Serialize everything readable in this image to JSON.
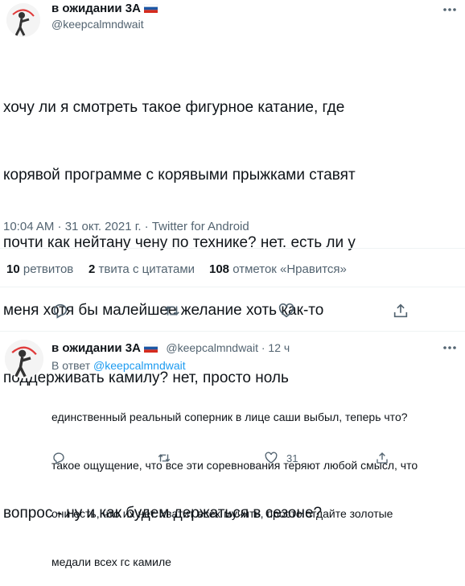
{
  "main_tweet": {
    "author_name": "в ожидании 3А",
    "author_handle": "@keepcalmndwait",
    "text_line_1": "хочу ли я смотреть такое фигурное катание, где",
    "text_line_2": "корявой программе с корявыми прыжками ставят",
    "text_line_3": "почти как нейтану чену по технике? нет. есть ли у",
    "text_line_4": "меня хотя бы малейшее желание хоть как-то",
    "text_line_5": "поддерживать камилу? нет, просто ноль",
    "text_line_6": "вопрос - ну и как будем держаться в сезоне?",
    "time": "10:04 AM · 31 окт. 2021 г. · Twitter for Android",
    "retweets_count": "10",
    "retweets_label": " ретвитов",
    "quotes_count": "2",
    "quotes_label": " твита с цитатами",
    "likes_count": "108",
    "likes_label": " отметок «Нравится»"
  },
  "reply_tweet": {
    "author_name": "в ожидании 3А",
    "author_handle": "@keepcalmndwait",
    "age": " · 12 ч",
    "reply_to_prefix": "В ответ ",
    "reply_to_handle": "@keepcalmndwait",
    "text_line_1": "единственный реальный соперник в лице саши выбыл, теперь что?",
    "text_line_2": "такое ощущение, что все эти соревнования теряют любой смысл, что",
    "text_line_3": "они есть, что их нет. хватит всех мучить, просто отдайте золотые",
    "text_line_4": "медали всех гс камиле",
    "likes_count": "31"
  },
  "colors": {
    "text": "#0f1419",
    "secondary": "#536471",
    "link": "#1d9bf0",
    "divider": "#eff3f4"
  },
  "icons": [
    "more-icon",
    "reply-icon",
    "retweet-icon",
    "like-icon",
    "share-icon",
    "russia-flag-icon"
  ]
}
